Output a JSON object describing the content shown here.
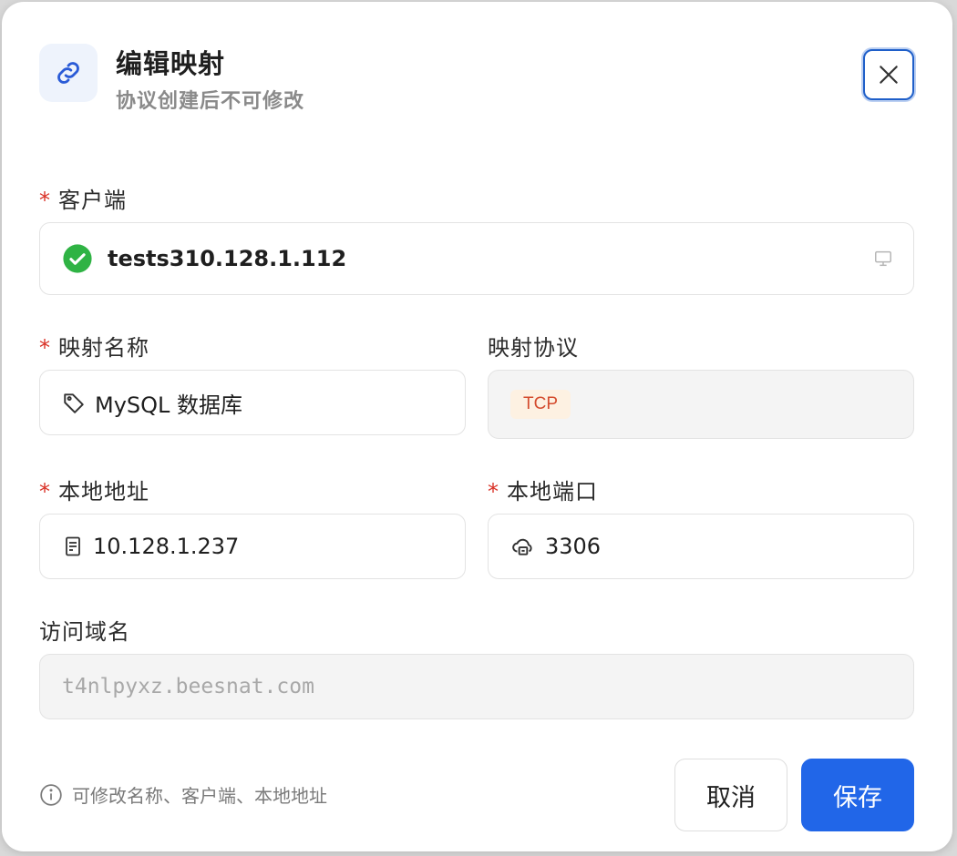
{
  "dialog": {
    "title": "编辑映射",
    "subtitle": "协议创建后不可修改"
  },
  "fields": {
    "client": {
      "label": "客户端",
      "value": "tests310.128.1.112",
      "icon": "check-circle-icon",
      "trailing_icon": "monitor-icon"
    },
    "mapping_name": {
      "label": "映射名称",
      "value": "MySQL 数据库",
      "icon": "tag-icon"
    },
    "protocol": {
      "label": "映射协议",
      "value": "TCP"
    },
    "local_address": {
      "label": "本地地址",
      "value": "10.128.1.237",
      "icon": "server-icon"
    },
    "local_port": {
      "label": "本地端口",
      "value": "3306",
      "icon": "cloud-port-icon"
    },
    "domain": {
      "label": "访问域名",
      "value": "t4nlpyxz.beesnat.com"
    }
  },
  "required_mark": "*",
  "footer": {
    "hint": "可修改名称、客户端、本地地址",
    "cancel_label": "取消",
    "save_label": "保存"
  },
  "colors": {
    "primary": "#2166e8",
    "required": "#d93025",
    "success": "#2fb344",
    "tcp_badge_bg": "#fdf1e2",
    "tcp_badge_text": "#d44c2e"
  }
}
